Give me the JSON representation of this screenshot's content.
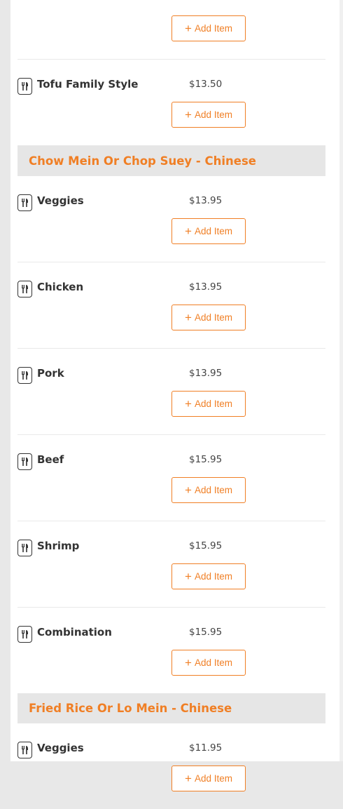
{
  "colors": {
    "accent": "#f07f25",
    "text": "#333333",
    "category_bg": "#e6e6e6"
  },
  "icons": {
    "dish": "utensils-icon",
    "add": "plus-icon"
  },
  "sections": [
    {
      "category": "",
      "items": [
        {
          "name": "",
          "price": "",
          "add_label": "Add Item"
        },
        {
          "name": "Tofu Family Style",
          "price": "$13.50",
          "add_label": "Add Item"
        }
      ]
    },
    {
      "category": "Chow Mein Or Chop Suey - Chinese",
      "items": [
        {
          "name": "Veggies",
          "price": "$13.95",
          "add_label": "Add Item"
        },
        {
          "name": "Chicken",
          "price": "$13.95",
          "add_label": "Add Item"
        },
        {
          "name": "Pork",
          "price": "$13.95",
          "add_label": "Add Item"
        },
        {
          "name": "Beef",
          "price": "$15.95",
          "add_label": "Add Item"
        },
        {
          "name": "Shrimp",
          "price": "$15.95",
          "add_label": "Add Item"
        },
        {
          "name": "Combination",
          "price": "$15.95",
          "add_label": "Add Item"
        }
      ]
    },
    {
      "category": "Fried Rice Or Lo Mein - Chinese",
      "items": [
        {
          "name": "Veggies",
          "price": "$11.95",
          "add_label": "Add Item"
        }
      ]
    }
  ]
}
